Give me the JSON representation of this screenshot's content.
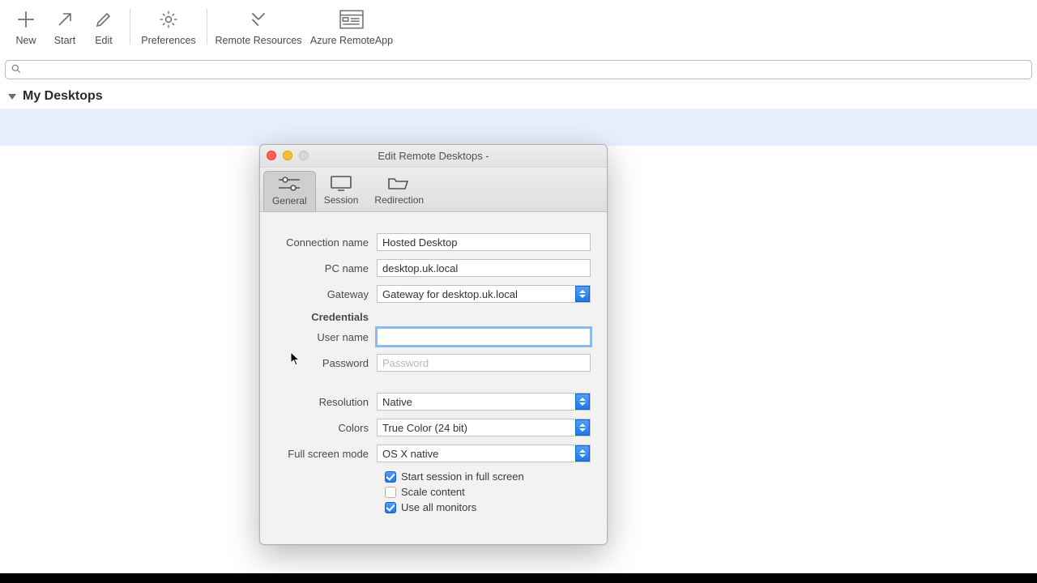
{
  "toolbar": {
    "new": "New",
    "start": "Start",
    "edit": "Edit",
    "preferences": "Preferences",
    "remote_resources": "Remote Resources",
    "azure_remoteapp": "Azure RemoteApp"
  },
  "search": {
    "placeholder": ""
  },
  "section_title": "My Desktops",
  "dialog": {
    "title": "Edit Remote Desktops -",
    "tabs": {
      "general": "General",
      "session": "Session",
      "redirection": "Redirection"
    },
    "fields": {
      "connection_name_label": "Connection name",
      "connection_name_value": "Hosted Desktop",
      "pc_name_label": "PC name",
      "pc_name_value": "desktop.uk.local",
      "gateway_label": "Gateway",
      "gateway_value": "Gateway for desktop.uk.local",
      "credentials_label": "Credentials",
      "user_name_label": "User name",
      "user_name_value": "",
      "password_label": "Password",
      "password_placeholder": "Password",
      "password_value": "",
      "resolution_label": "Resolution",
      "resolution_value": "Native",
      "colors_label": "Colors",
      "colors_value": "True Color (24 bit)",
      "fullscreen_mode_label": "Full screen mode",
      "fullscreen_mode_value": "OS X native",
      "cb_start_fullscreen": "Start session in full screen",
      "cb_scale_content": "Scale content",
      "cb_use_all_monitors": "Use all monitors"
    },
    "checkboxes": {
      "start_fullscreen": true,
      "scale_content": false,
      "use_all_monitors": true
    }
  }
}
